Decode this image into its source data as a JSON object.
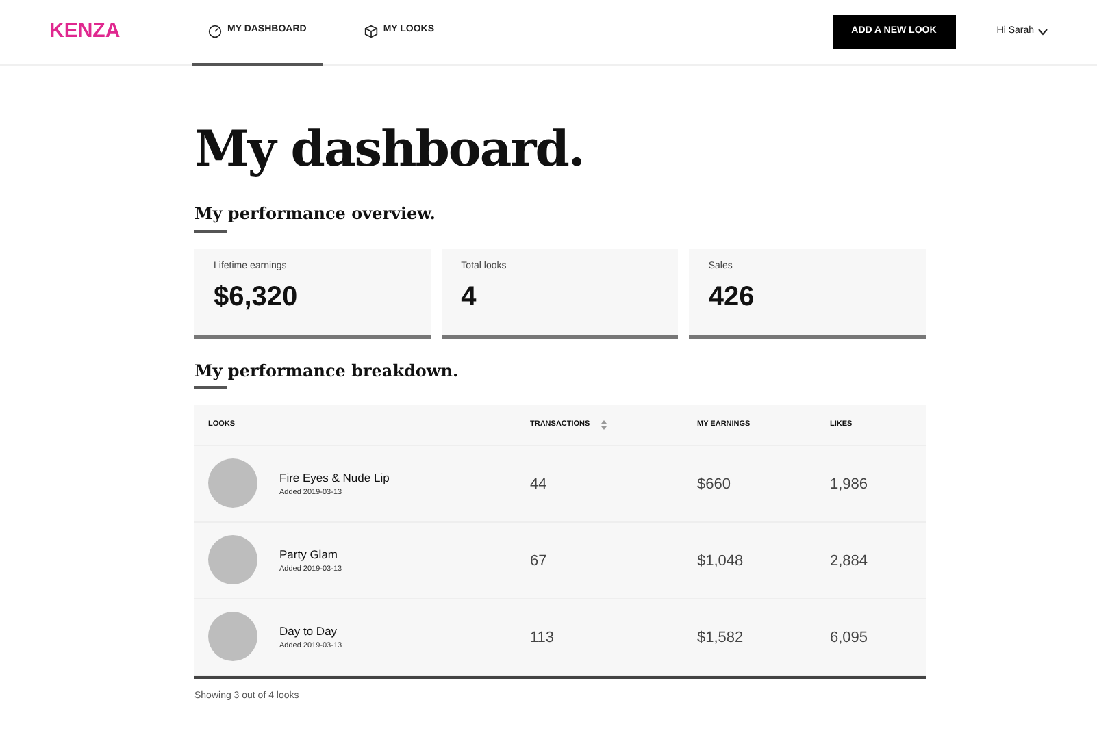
{
  "brand": "KENZA",
  "nav": [
    {
      "label": "MY DASHBOARD",
      "selected": true
    },
    {
      "label": "MY LOOKS",
      "selected": false
    }
  ],
  "cta": "ADD A NEW LOOK",
  "user": "Hi Sarah",
  "title": "My dashboard.",
  "overview": {
    "heading": "My performance overview.",
    "stats": [
      {
        "label": "Lifetime earnings",
        "value": "$6,320"
      },
      {
        "label": "Total looks",
        "value": "4"
      },
      {
        "label": "Sales",
        "value": "426"
      }
    ]
  },
  "breakdown": {
    "heading": "My performance breakdown.",
    "columns": [
      {
        "label": "LOOKS",
        "sortable": false
      },
      {
        "label": "TRANSACTIONS",
        "sortable": true
      },
      {
        "label": "MY EARNINGS",
        "sortable": false
      },
      {
        "label": "LIKES",
        "sortable": false
      }
    ],
    "rows": [
      {
        "name": "Fire Eyes & Nude Lip",
        "added": "Added 2019-03-13",
        "transactions": "44",
        "earnings": "$660",
        "likes": "1,986"
      },
      {
        "name": "Party Glam",
        "added": "Added 2019-03-13",
        "transactions": "67",
        "earnings": "$1,048",
        "likes": "2,884"
      },
      {
        "name": "Day to Day",
        "added": "Added 2019-03-13",
        "transactions": "113",
        "earnings": "$1,582",
        "likes": "6,095"
      }
    ],
    "footer": "Showing 3 out of 4 looks"
  }
}
